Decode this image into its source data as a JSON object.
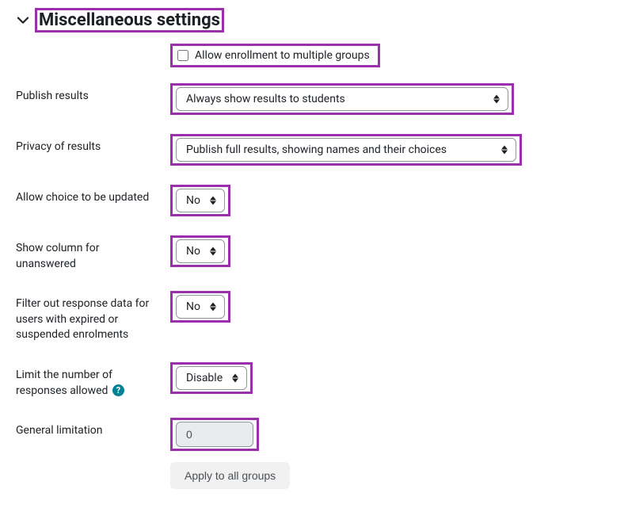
{
  "section": {
    "title": "Miscellaneous settings"
  },
  "fields": {
    "allow_multi": {
      "label": "Allow enrollment to multiple groups",
      "checked": false
    },
    "publish_results": {
      "label": "Publish results",
      "value": "Always show results to students"
    },
    "privacy": {
      "label": "Privacy of results",
      "value": "Publish full results, showing names and their choices"
    },
    "allow_update": {
      "label": "Allow choice to be updated",
      "value": "No"
    },
    "show_unanswered": {
      "label": "Show column for unanswered",
      "value": "No"
    },
    "filter_expired": {
      "label": "Filter out response data for users with expired or suspended enrolments",
      "value": "No"
    },
    "limit_responses": {
      "label": "Limit the number of responses allowed",
      "value": "Disable"
    },
    "general_limitation": {
      "label": "General limitation",
      "value": "0"
    },
    "apply_button": "Apply to all groups"
  },
  "colors": {
    "highlight": "#9b2fae",
    "help_icon_bg": "#008196"
  }
}
